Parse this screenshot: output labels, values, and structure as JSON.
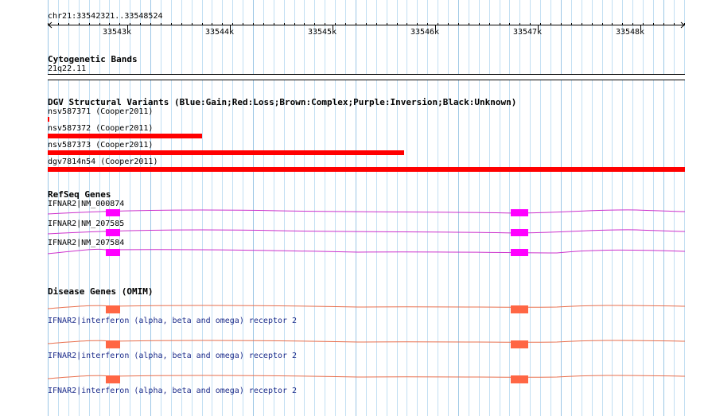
{
  "ruler": {
    "location": "chr21:33542321..33548524",
    "ticks": [
      "33543k",
      "33544k",
      "33545k",
      "33546k",
      "33547k",
      "33548k"
    ]
  },
  "tracks": {
    "cytobands": {
      "title": "Cytogenetic Bands",
      "band": "21q22.11"
    },
    "dgv": {
      "title": "DGV Structural Variants (Blue:Gain;Red:Loss;Brown:Complex;Purple:Inversion;Black:Unknown)",
      "color": "#ff0000",
      "items": [
        {
          "label": "nsv587371 (Cooper2011)"
        },
        {
          "label": "nsv587372 (Cooper2011)"
        },
        {
          "label": "nsv587373 (Cooper2011)"
        },
        {
          "label": "dgv7814n54 (Cooper2011)"
        }
      ]
    },
    "refseq": {
      "title": "RefSeq Genes",
      "color": "#ff00ff",
      "line_color": "#cc33cc",
      "items": [
        {
          "label": "IFNAR2|NM_000874"
        },
        {
          "label": "IFNAR2|NM_207585"
        },
        {
          "label": "IFNAR2|NM_207584"
        }
      ]
    },
    "omim": {
      "title": "Disease Genes (OMIM)",
      "color": "#ff6644",
      "line_color": "#e8704f",
      "items": [
        {
          "label": "IFNAR2|interferon (alpha, beta and omega) receptor 2"
        },
        {
          "label": "IFNAR2|interferon (alpha, beta and omega) receptor 2"
        },
        {
          "label": "IFNAR2|interferon (alpha, beta and omega) receptor 2"
        }
      ]
    }
  }
}
